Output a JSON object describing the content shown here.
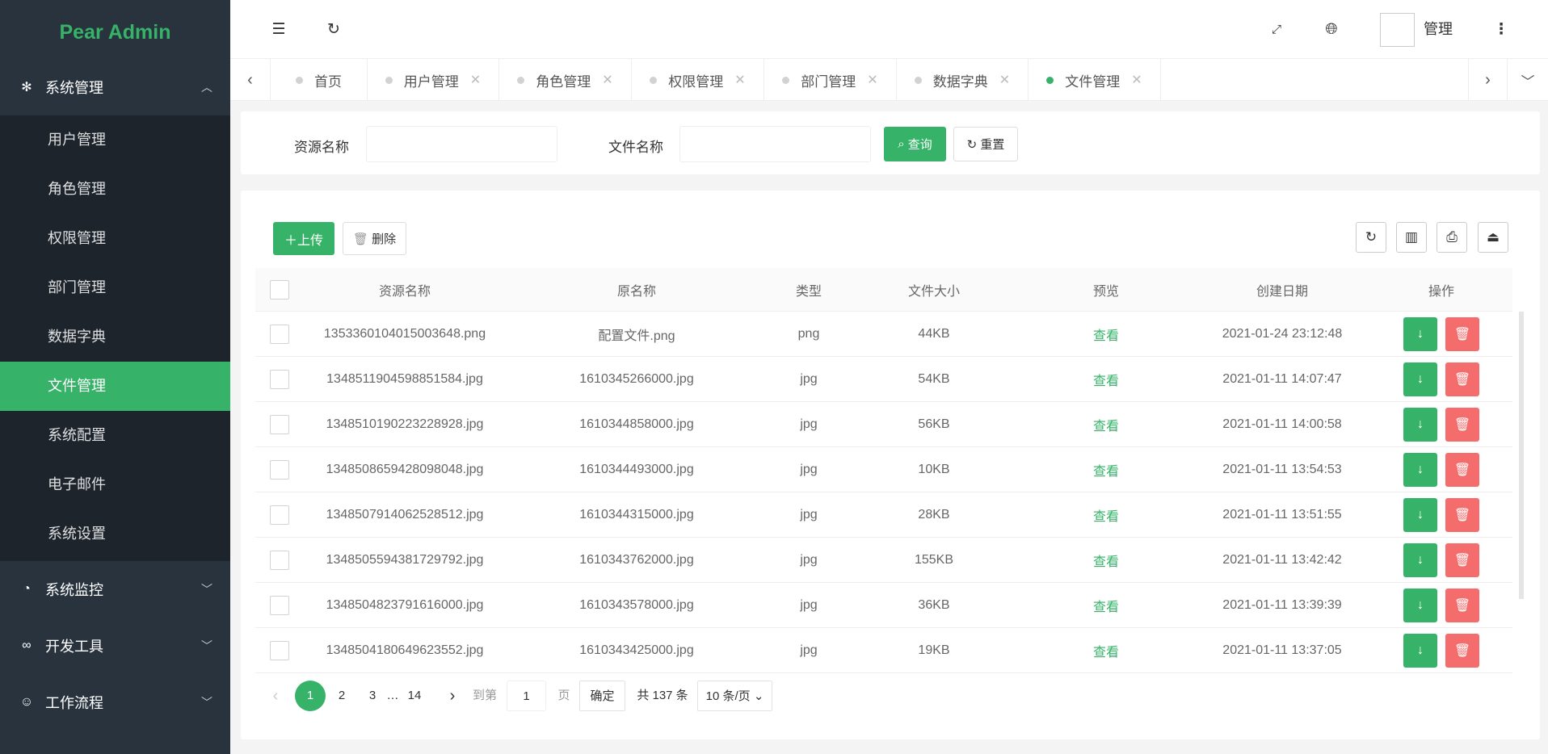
{
  "app": {
    "title": "Pear Admin",
    "accent": "#36b368",
    "danger": "#f56c6c"
  },
  "sidebar": {
    "groups": [
      {
        "label": "系统管理",
        "icon": "gear-icon",
        "expanded": true,
        "items": [
          {
            "label": "用户管理"
          },
          {
            "label": "角色管理"
          },
          {
            "label": "权限管理"
          },
          {
            "label": "部门管理"
          },
          {
            "label": "数据字典"
          },
          {
            "label": "文件管理",
            "active": true
          },
          {
            "label": "系统配置"
          },
          {
            "label": "电子邮件"
          },
          {
            "label": "系统设置"
          }
        ]
      },
      {
        "label": "系统监控",
        "icon": "dashboard-icon"
      },
      {
        "label": "开发工具",
        "icon": "infinity-icon"
      },
      {
        "label": "工作流程",
        "icon": "smile-icon"
      }
    ]
  },
  "header": {
    "user": "管理"
  },
  "tabs": [
    {
      "label": "首页"
    },
    {
      "label": "用户管理"
    },
    {
      "label": "角色管理"
    },
    {
      "label": "权限管理"
    },
    {
      "label": "部门管理"
    },
    {
      "label": "数据字典"
    },
    {
      "label": "文件管理",
      "active": true
    }
  ],
  "search": {
    "field1_label": "资源名称",
    "field1_value": "",
    "field2_label": "文件名称",
    "field2_value": "",
    "query": "查询",
    "reset": "重置"
  },
  "toolbar": {
    "upload": "上传",
    "delete": "删除"
  },
  "table": {
    "columns": [
      "资源名称",
      "原名称",
      "类型",
      "文件大小",
      "预览",
      "创建日期",
      "操作"
    ],
    "rows": [
      [
        "1353360104015003648.png",
        "配置文件.png",
        "png",
        "44KB",
        "查看",
        "2021-01-24 23:12:48"
      ],
      [
        "1348511904598851584.jpg",
        "1610345266000.jpg",
        "jpg",
        "54KB",
        "查看",
        "2021-01-11 14:07:47"
      ],
      [
        "1348510190223228928.jpg",
        "1610344858000.jpg",
        "jpg",
        "56KB",
        "查看",
        "2021-01-11 14:00:58"
      ],
      [
        "1348508659428098048.jpg",
        "1610344493000.jpg",
        "jpg",
        "10KB",
        "查看",
        "2021-01-11 13:54:53"
      ],
      [
        "1348507914062528512.jpg",
        "1610344315000.jpg",
        "jpg",
        "28KB",
        "查看",
        "2021-01-11 13:51:55"
      ],
      [
        "1348505594381729792.jpg",
        "1610343762000.jpg",
        "jpg",
        "155KB",
        "查看",
        "2021-01-11 13:42:42"
      ],
      [
        "1348504823791616000.jpg",
        "1610343578000.jpg",
        "jpg",
        "36KB",
        "查看",
        "2021-01-11 13:39:39"
      ],
      [
        "1348504180649623552.jpg",
        "1610343425000.jpg",
        "jpg",
        "19KB",
        "查看",
        "2021-01-11 13:37:05"
      ]
    ]
  },
  "pagination": {
    "pages": [
      "1",
      "2",
      "3",
      "…",
      "14"
    ],
    "current": "1",
    "goto_label": "到第",
    "goto_value": "1",
    "page_unit": "页",
    "confirm": "确定",
    "total": "共 137 条",
    "page_size": "10 条/页"
  }
}
